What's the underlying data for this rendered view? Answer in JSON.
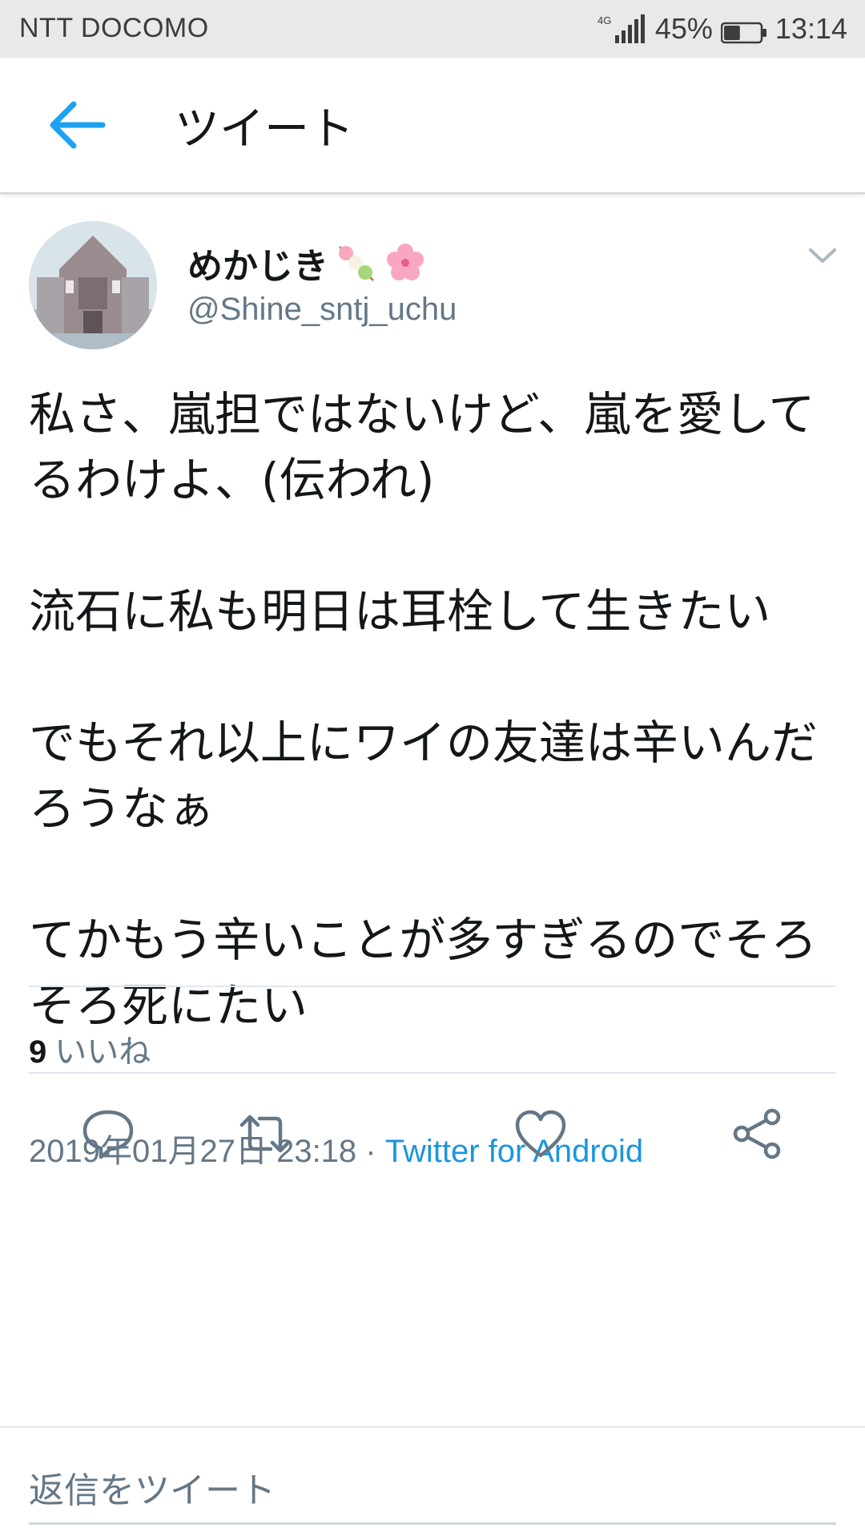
{
  "status_bar": {
    "carrier": "NTT DOCOMO",
    "network": "4G",
    "battery": "45%",
    "battery_level": 0.45,
    "time": "13:14"
  },
  "header": {
    "back_icon": "arrow-left-icon",
    "title": "ツイート"
  },
  "tweet": {
    "user": {
      "display_name": "めかじき",
      "emojis": [
        "dango-icon",
        "cherry-blossom-icon"
      ],
      "handle": "@Shine_sntj_uchu"
    },
    "menu_icon": "chevron-down-icon",
    "text": "私さ、嵐担ではないけど、嵐を愛してるわけよ、(伝われ)\n\n流石に私も明日は耳栓して生きたい\n\nでもそれ以上にワイの友達は辛いんだろうなぁ\n\nてかもう辛いことが多すぎるのでそろそろ死にたい",
    "timestamp": "2019年01月27日 23:18",
    "separator": " · ",
    "source": "Twitter for Android",
    "likes_count": "9",
    "likes_label": "いいね"
  },
  "actions": [
    "reply-icon",
    "retweet-icon",
    "like-icon",
    "share-icon"
  ],
  "reply": {
    "placeholder": "返信をツイート"
  },
  "colors": {
    "accent": "#1da1f2",
    "link": "#1b95e0",
    "secondary_text": "#657786",
    "divider": "#e1e8ed"
  }
}
